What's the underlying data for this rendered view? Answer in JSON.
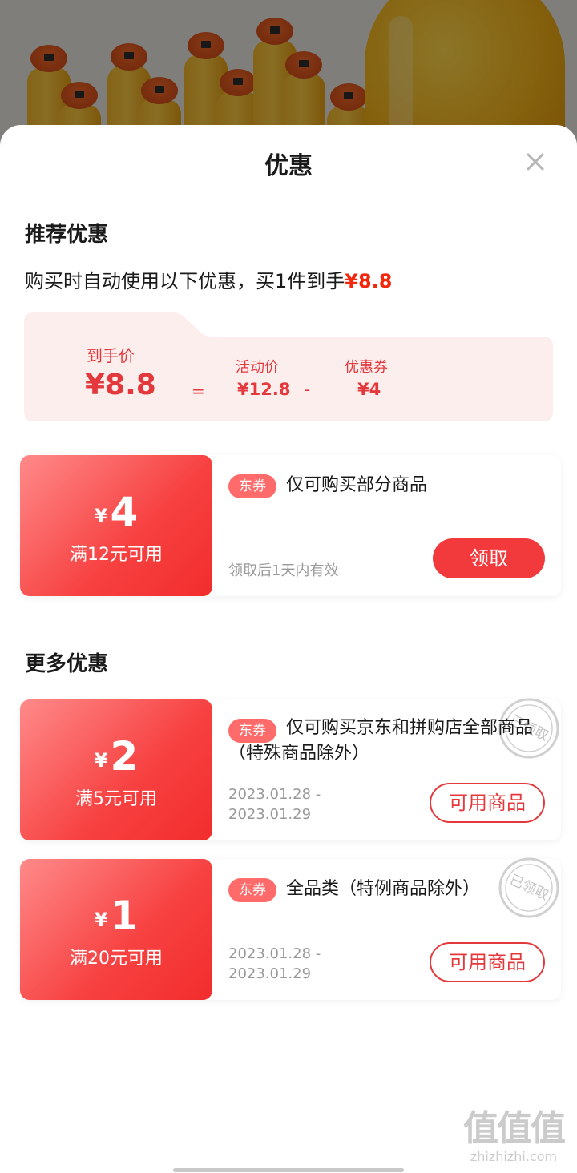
{
  "sheet": {
    "title": "优惠",
    "close_icon": "close-icon"
  },
  "recommended": {
    "title": "推荐优惠",
    "auto_text": "购买时自动使用以下优惠，买1件到手",
    "auto_price": "¥8.8",
    "breakdown": {
      "final_label": "到手价",
      "final_value": "¥8.8",
      "equals": "=",
      "activity_label": "活动价",
      "activity_value": "¥12.8",
      "minus": "-",
      "coupon_label": "优惠券",
      "coupon_value": "¥4"
    },
    "coupon": {
      "yen": "¥",
      "amount": "4",
      "condition": "满12元可用",
      "tag": "东券",
      "description": "仅可购买部分商品",
      "validity": "领取后1天内有效",
      "button": "领取"
    }
  },
  "more": {
    "title": "更多优惠",
    "coupons": [
      {
        "yen": "¥",
        "amount": "2",
        "condition": "满5元可用",
        "tag": "东券",
        "description": "仅可购买京东和拼购店全部商品（特殊商品除外）",
        "date_start": "2023.01.28  -",
        "date_end": "2023.01.29",
        "button": "可用商品",
        "stamp": "已领取"
      },
      {
        "yen": "¥",
        "amount": "1",
        "condition": "满20元可用",
        "tag": "东券",
        "description": "全品类（特例商品除外）",
        "date_start": "2023.01.28  -",
        "date_end": "2023.01.29",
        "button": "可用商品",
        "stamp": "已领取"
      }
    ]
  },
  "watermark": {
    "logo": "值值值",
    "url": "zhizhizhi.com"
  },
  "colors": {
    "accent": "#e4393c",
    "coupon_gradient_start": "#ff8a8a",
    "coupon_gradient_end": "#f22d2d",
    "breakdown_bg": "#fdeeee"
  }
}
